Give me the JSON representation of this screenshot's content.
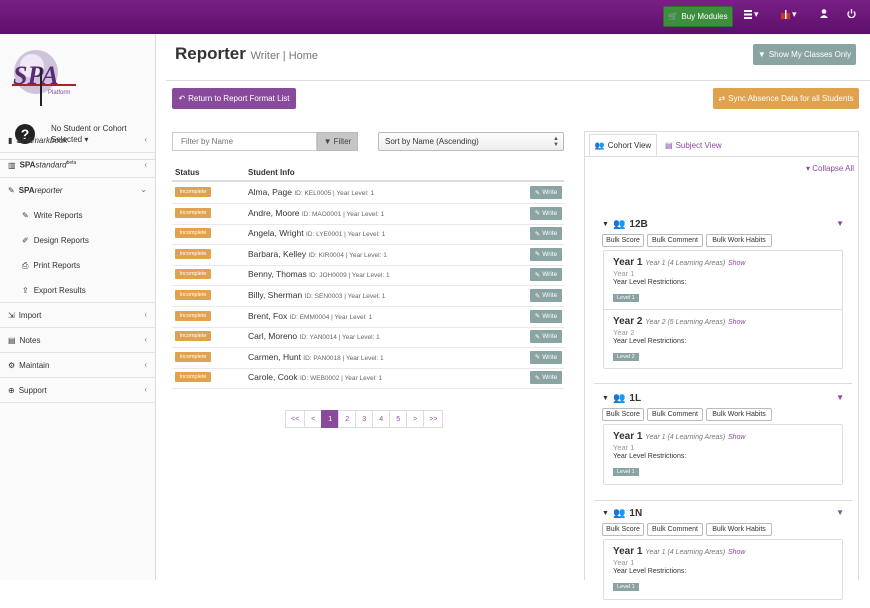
{
  "topbar": {
    "buy_modules": "Buy Modules",
    "icons": [
      "database-icon",
      "gift-icon",
      "user-icon",
      "power-icon"
    ]
  },
  "sidebar": {
    "logo_text": "SPA",
    "logo_sub": "Platform",
    "no_student_line1": "No Student or Cohort",
    "no_student_line2": "Selected",
    "items": [
      {
        "prefix": "SPA",
        "name": "markbook",
        "sup": "",
        "icon": "book-icon"
      },
      {
        "prefix": "SPA",
        "name": "standard",
        "sup": "beta",
        "icon": "chart-icon"
      },
      {
        "prefix": "SPA",
        "name": "reporter",
        "sup": "",
        "icon": "pencil-square-icon"
      }
    ],
    "sub_items": [
      "Write Reports",
      "Design Reports",
      "Print Reports",
      "Export Results"
    ],
    "bottom_items": [
      {
        "label": "Import",
        "icon": "import-icon"
      },
      {
        "label": "Notes",
        "icon": "notes-icon"
      },
      {
        "label": "Maintain",
        "icon": "cogs-icon"
      },
      {
        "label": "Support",
        "icon": "lifebuoy-icon"
      }
    ]
  },
  "header": {
    "title": "Reporter",
    "breadcrumb": "Writer | Home",
    "show_my_classes": "Show My Classes Only"
  },
  "toolbar": {
    "return_label": "Return to Report Format List",
    "sync_label": "Sync Absence Data for all Students",
    "filter_placeholder": "Filter by Name",
    "filter_button": "Filter",
    "sort_value": "Sort by Name (Ascending)"
  },
  "table": {
    "columns": [
      "Status",
      "Student Info"
    ],
    "write_label": "Write",
    "rows": [
      {
        "status": "Incomplete",
        "name": "Alma, Page",
        "id": "ID: KEL0005",
        "year": "Year Level: 1"
      },
      {
        "status": "Incomplete",
        "name": "Andre, Moore",
        "id": "ID: MAO0001",
        "year": "Year Level: 1"
      },
      {
        "status": "Incomplete",
        "name": "Angela, Wright",
        "id": "ID: LYE0001",
        "year": "Year Level: 1"
      },
      {
        "status": "Incomplete",
        "name": "Barbara, Kelley",
        "id": "ID: KIR0004",
        "year": "Year Level: 1"
      },
      {
        "status": "Incomplete",
        "name": "Benny, Thomas",
        "id": "ID: JOH0009",
        "year": "Year Level: 1"
      },
      {
        "status": "Incomplete",
        "name": "Billy, Sherman",
        "id": "ID: SEN0003",
        "year": "Year Level: 1"
      },
      {
        "status": "Incomplete",
        "name": "Brent, Fox",
        "id": "ID: EMM0004",
        "year": "Year Level: 1"
      },
      {
        "status": "Incomplete",
        "name": "Carl, Moreno",
        "id": "ID: YAN0014",
        "year": "Year Level: 1"
      },
      {
        "status": "Incomplete",
        "name": "Carmen, Hunt",
        "id": "ID: PAN0018",
        "year": "Year Level: 1"
      },
      {
        "status": "Incomplete",
        "name": "Carole, Cook",
        "id": "ID: WEB0002",
        "year": "Year Level: 1"
      }
    ]
  },
  "pagination": [
    "<<",
    "<",
    "1",
    "2",
    "3",
    "4",
    "5",
    ">",
    ">>"
  ],
  "pagination_active": "1",
  "right_panel": {
    "tab_cohort": "Cohort View",
    "tab_subject": "Subject View",
    "collapse_all": "Collapse All",
    "bulk_buttons": [
      "Bulk Score",
      "Bulk Comment",
      "Bulk Work Habits"
    ],
    "show_label": "Show",
    "restrictions_label": "Year Level Restrictions:",
    "cohorts": [
      {
        "name": "12B",
        "years": [
          {
            "title": "Year 1",
            "sub": "Year 1 (4 Learning Areas)",
            "grey": "Year 1",
            "level": "Level 1"
          },
          {
            "title": "Year 2",
            "sub": "Year 2 (5 Learning Areas)",
            "grey": "Year 2",
            "level": "Level 2"
          }
        ]
      },
      {
        "name": "1L",
        "years": [
          {
            "title": "Year 1",
            "sub": "Year 1 (4 Learning Areas)",
            "grey": "Year 1",
            "level": "Level 1"
          }
        ]
      },
      {
        "name": "1N",
        "years": [
          {
            "title": "Year 1",
            "sub": "Year 1 (4 Learning Areas)",
            "grey": "Year 1",
            "level": "Level 1"
          }
        ]
      }
    ]
  },
  "colors": {
    "topbar": "#6a1678",
    "accent": "#8a4a9c",
    "buy_green": "#3e8e3e",
    "incomplete_orange": "#e0a24d",
    "write_grey": "#8aa3a3"
  }
}
